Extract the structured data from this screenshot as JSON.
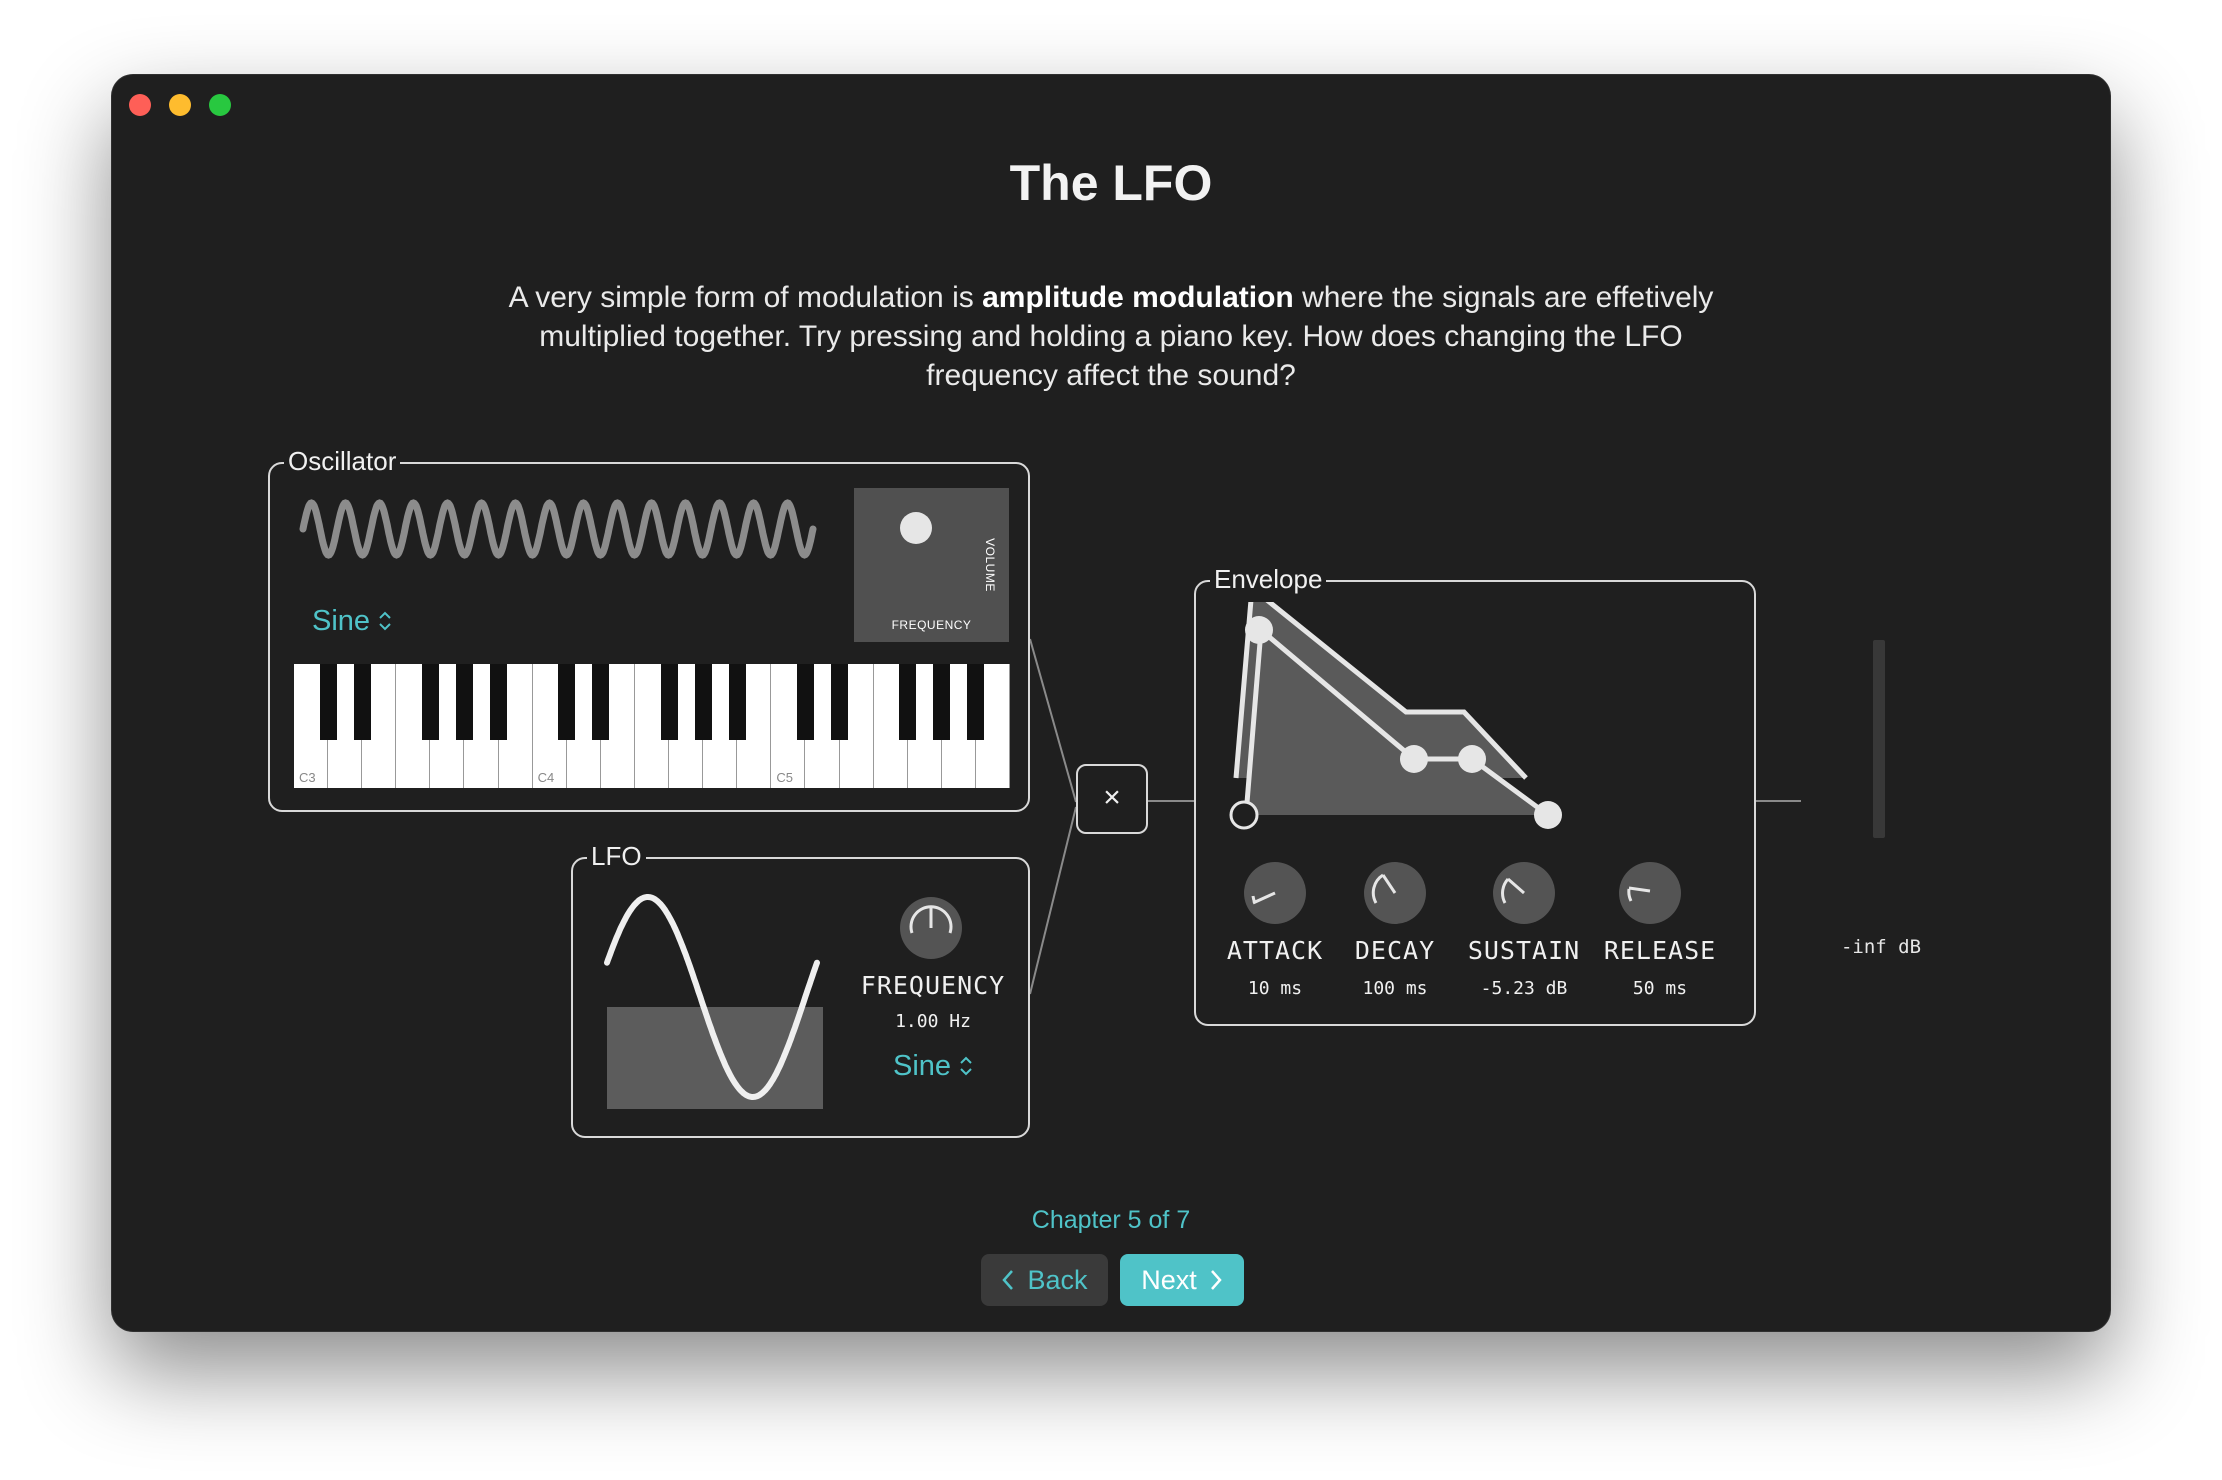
{
  "page": {
    "title": "The LFO",
    "intro_before": "A very simple form of modulation is ",
    "intro_bold": "amplitude modulation",
    "intro_after": " where the signals are effetively multiplied together. Try pressing and holding a piano key. How does changing the LFO frequency affect the sound?"
  },
  "oscillator": {
    "title": "Oscillator",
    "waveform_label": "Sine",
    "pad_x_label": "FREQUENCY",
    "pad_y_label": "VOLUME",
    "piano_labels": [
      "C3",
      "C4",
      "C5"
    ]
  },
  "lfo": {
    "title": "LFO",
    "frequency_label": "FREQUENCY",
    "frequency_value": "1.00 Hz",
    "waveform_label": "Sine"
  },
  "multiplier": {
    "symbol": "×"
  },
  "envelope": {
    "title": "Envelope",
    "knobs": [
      {
        "label": "ATTACK",
        "value": "10 ms"
      },
      {
        "label": "DECAY",
        "value": "100 ms"
      },
      {
        "label": "SUSTAIN",
        "value": "-5.23 dB"
      },
      {
        "label": "RELEASE",
        "value": "50 ms"
      }
    ]
  },
  "meter": {
    "label": "-inf dB"
  },
  "navigation": {
    "chapter": "Chapter 5 of 7",
    "back_label": "Back",
    "next_label": "Next"
  },
  "colors": {
    "accent": "#4fc3c8",
    "window_bg": "#1f1f1f",
    "panel_fill": "#5a5a5a"
  },
  "icons": {
    "select_chevron": "chevron-up-down-icon",
    "back": "chevron-left-icon",
    "next": "chevron-right-icon"
  }
}
